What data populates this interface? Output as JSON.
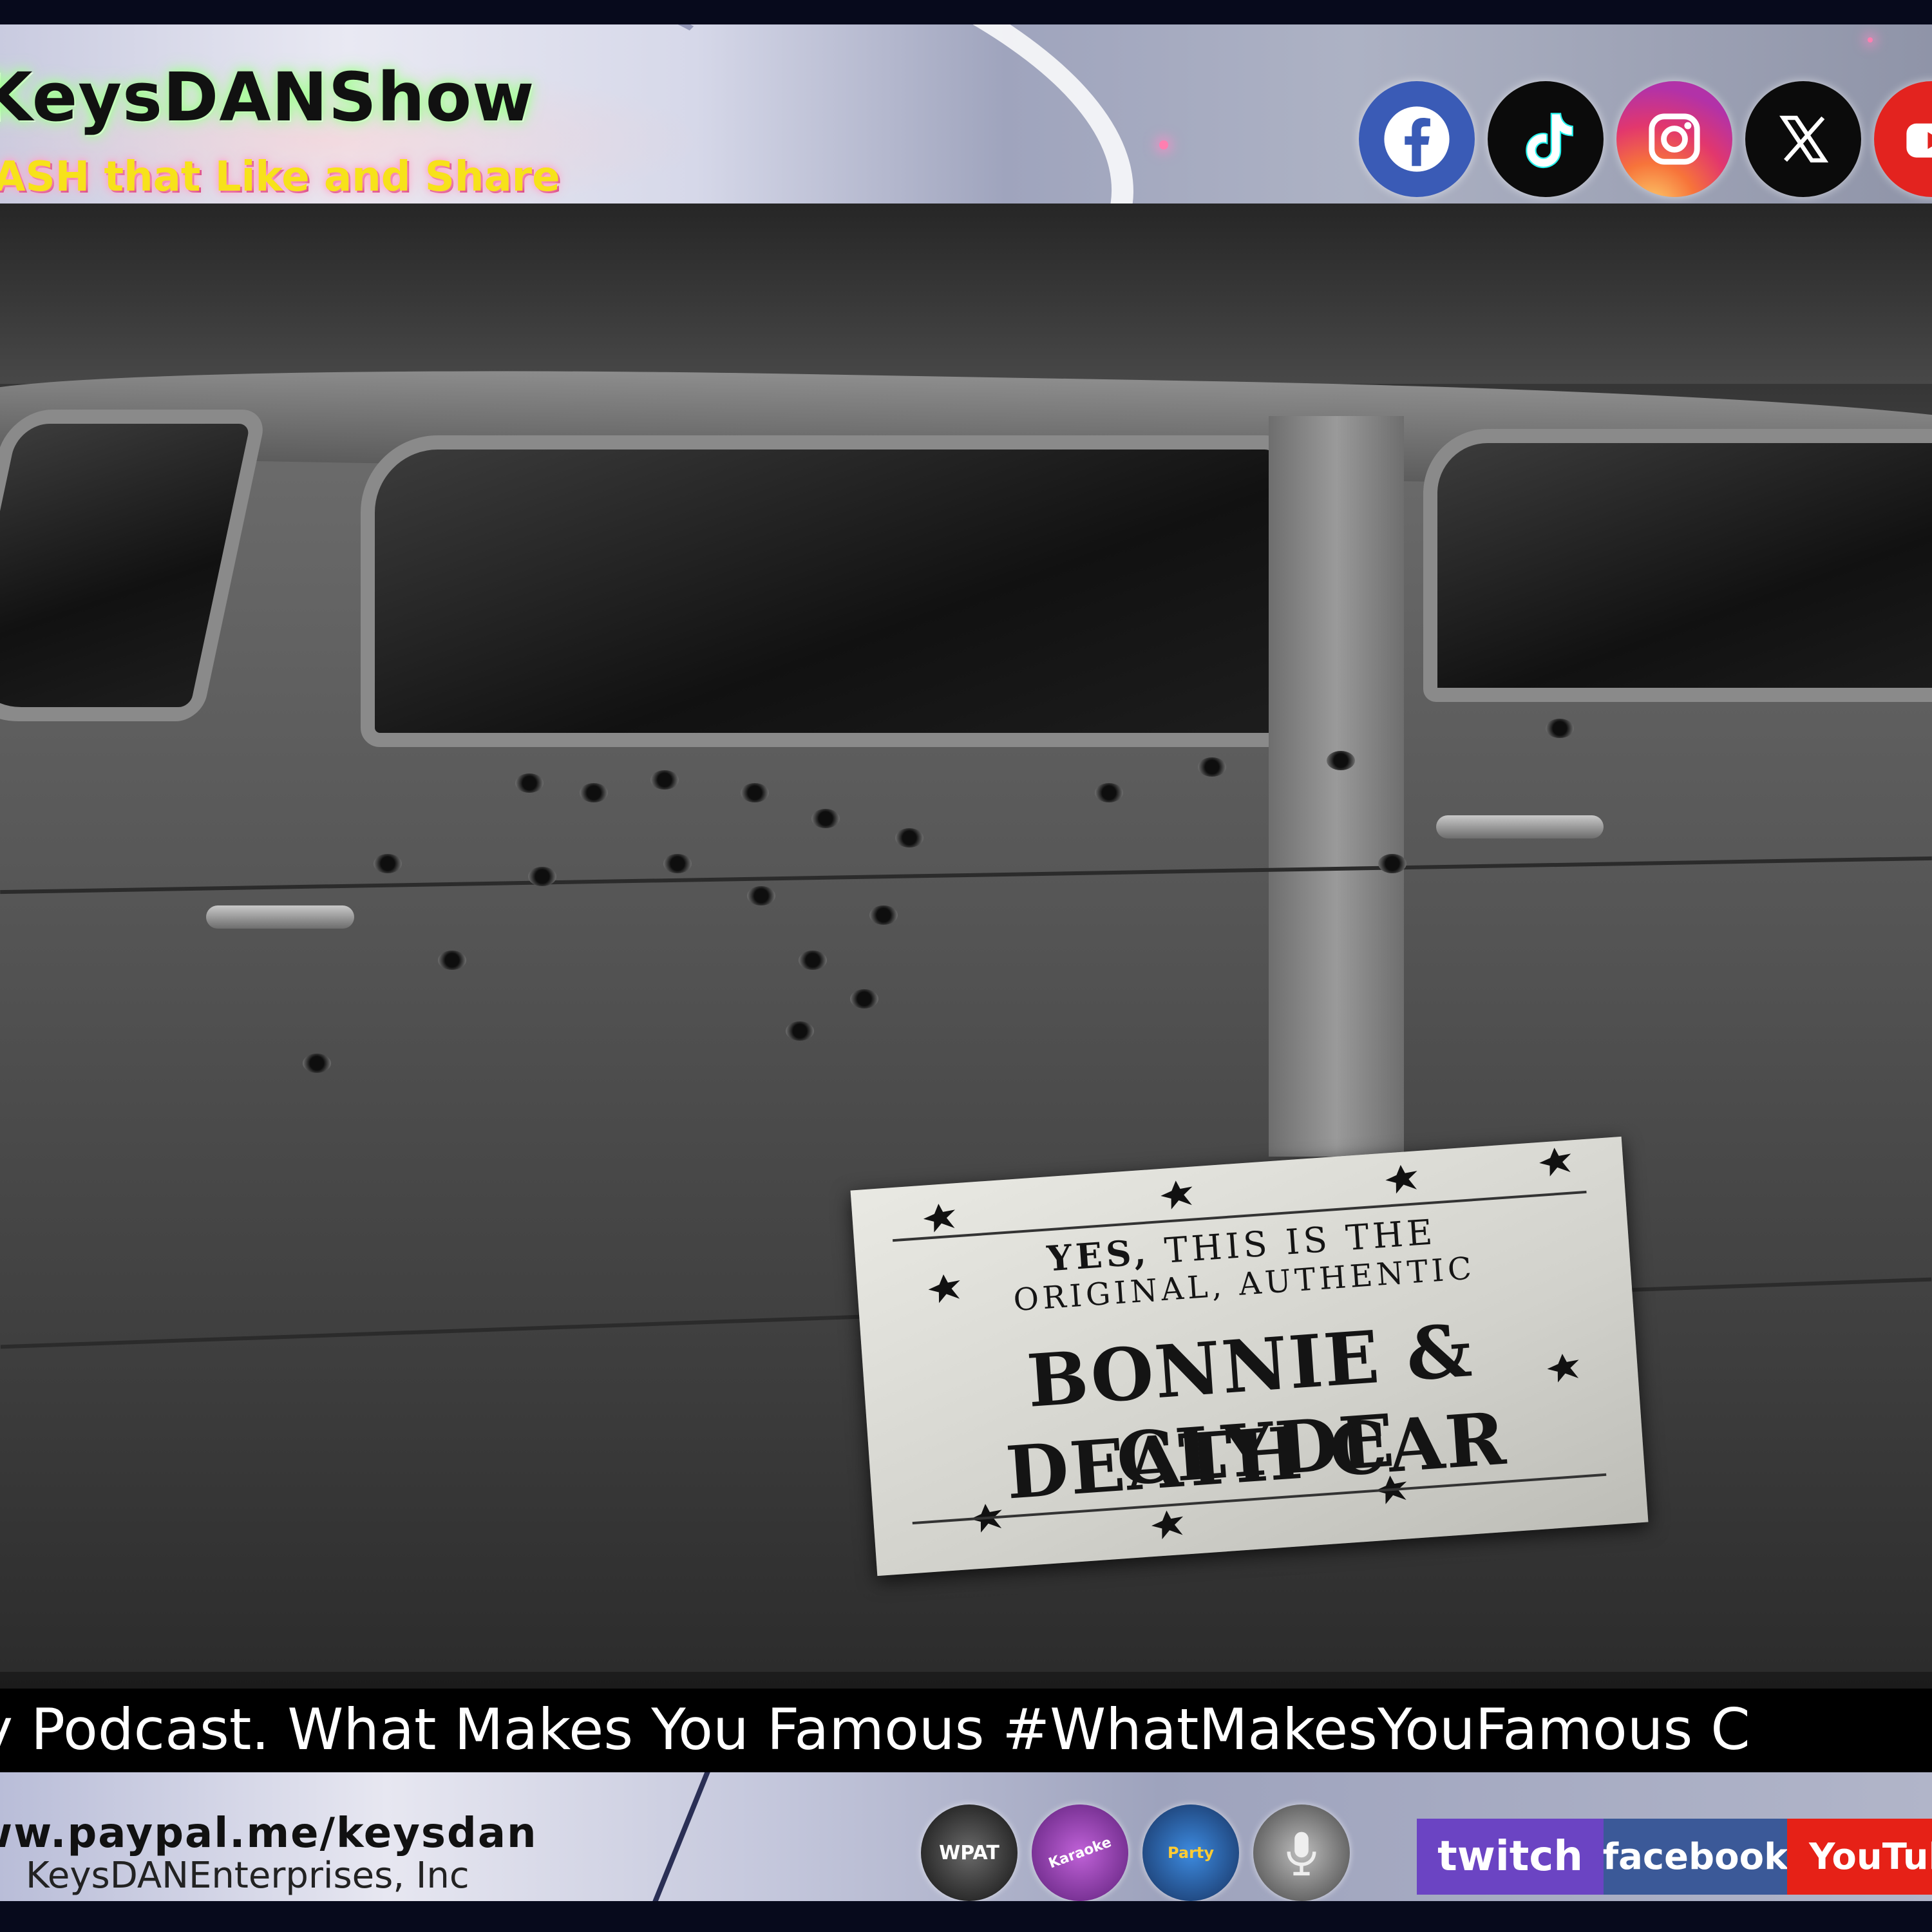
{
  "header": {
    "title": "KeysDANShow",
    "subtitle": "ASH that Like and Share",
    "social_icons": [
      "facebook-icon",
      "tiktok-icon",
      "instagram-icon",
      "x-icon",
      "youtube-icon"
    ]
  },
  "photo": {
    "sign": {
      "line1_bold": "YES,",
      "line1_rest": " THIS IS THE",
      "line2": "ORIGINAL, AUTHENTIC",
      "line3": "BONNIE & CLYDE",
      "line4": "DEATH CAR"
    }
  },
  "ticker": {
    "text": "y Podcast. What Makes You Famous #WhatMakesYouFamous C"
  },
  "footer": {
    "paypal_url": "ww.paypal.me/keysdan",
    "company": "KeysDANEnterprises, Inc",
    "badges": [
      "WPAT",
      "Karaoke",
      "Party",
      "mic"
    ],
    "platforms": {
      "twitch": "twitch",
      "facebook": "facebook",
      "youtube": "YouTube"
    }
  },
  "colors": {
    "twitch": "#6b44c3",
    "facebook": "#3b5998",
    "youtube": "#e62117",
    "subtitle_yellow": "#f7e21a"
  }
}
